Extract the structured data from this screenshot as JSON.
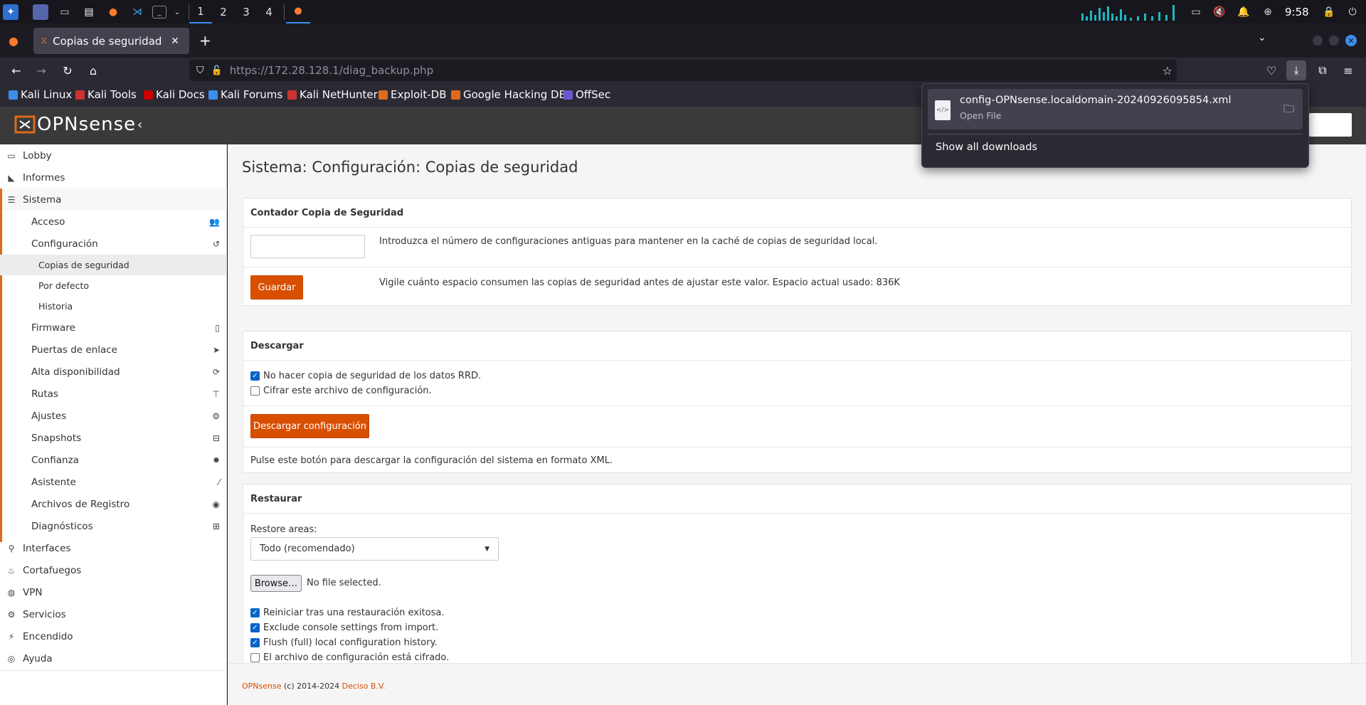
{
  "taskbar": {
    "workspaces": [
      "1",
      "2",
      "3",
      "4"
    ],
    "clock": "9:58"
  },
  "browser": {
    "tab_title": "Copias de seguridad | Con",
    "url": "https://172.28.128.1/diag_backup.php",
    "url_host": "172.28.128.1",
    "url_path": "/diag_backup.php",
    "bookmarks": [
      "Kali Linux",
      "Kali Tools",
      "Kali Docs",
      "Kali Forums",
      "Kali NetHunter",
      "Exploit-DB",
      "Google Hacking DB",
      "OffSec"
    ]
  },
  "download_popup": {
    "filename": "config-OPNsense.localdomain-20240926095854.xml",
    "sub": "Open File",
    "show_all": "Show all downloads"
  },
  "brand": {
    "logo": "OPNsense"
  },
  "sidebar": {
    "lobby": "Lobby",
    "informes": "Informes",
    "sistema": "Sistema",
    "acceso": "Acceso",
    "configuracion": "Configuración",
    "copias": "Copias de seguridad",
    "por_defecto": "Por defecto",
    "historia": "Historia",
    "firmware": "Firmware",
    "puertas": "Puertas de enlace",
    "alta": "Alta disponibilidad",
    "rutas": "Rutas",
    "ajustes": "Ajustes",
    "snapshots": "Snapshots",
    "confianza": "Confianza",
    "asistente": "Asistente",
    "archivos": "Archivos de Registro",
    "diagnosticos": "Diagnósticos",
    "interfaces": "Interfaces",
    "cortafuegos": "Cortafuegos",
    "vpn": "VPN",
    "servicios": "Servicios",
    "encendido": "Encendido",
    "ayuda": "Ayuda"
  },
  "page": {
    "title": "Sistema: Configuración: Copias de seguridad",
    "counter": {
      "header": "Contador Copia de Seguridad",
      "input_value": "",
      "help1": "Introduzca el número de configuraciones antiguas para mantener en la caché de copias de seguridad local.",
      "save": "Guardar",
      "help2": "Vigile cuánto espacio consumen las copias de seguridad antes de ajustar este valor. Espacio actual usado: 836K"
    },
    "download": {
      "header": "Descargar",
      "cb_rrd": "No hacer copia de seguridad de los datos RRD.",
      "cb_encrypt": "Cifrar este archivo de configuración.",
      "button": "Descargar configuración",
      "help": "Pulse este botón para descargar la configuración del sistema en formato XML."
    },
    "restore": {
      "header": "Restaurar",
      "areas_label": "Restore areas:",
      "areas_value": "Todo (recomendado)",
      "browse": "Browse…",
      "no_file": "No file selected.",
      "cb_reboot": "Reiniciar tras una restauración exitosa.",
      "cb_console": "Exclude console settings from import.",
      "cb_flush": "Flush (full) local configuration history.",
      "cb_encrypted": "El archivo de configuración está cifrado."
    },
    "footer": {
      "brand": "OPNsense",
      "copy": "(c) 2014-2024",
      "company": "Deciso B.V."
    }
  },
  "colors": {
    "accent": "#d94f00",
    "checkbox": "#0a64c8"
  }
}
